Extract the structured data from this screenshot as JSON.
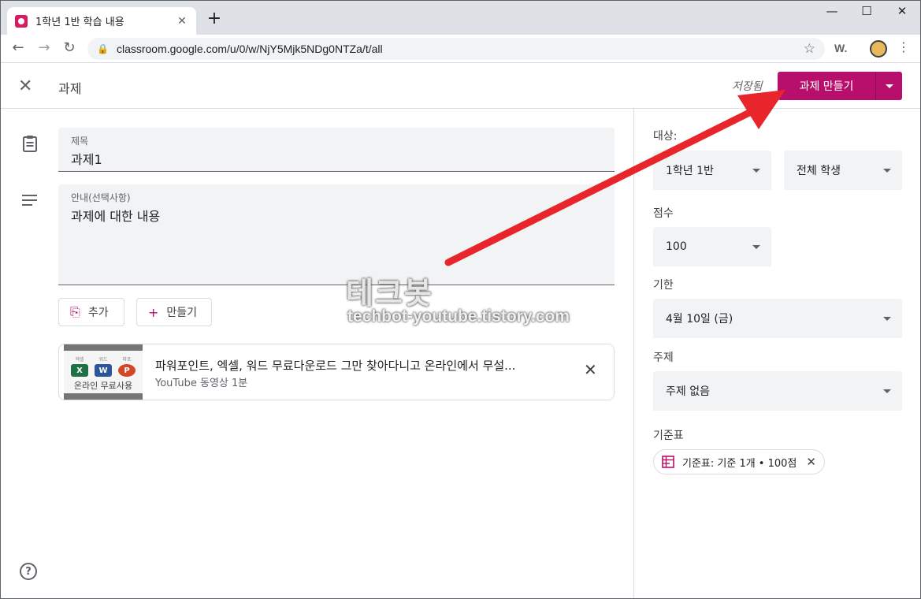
{
  "browser": {
    "tab_title": "1학년 1반 학습 내용",
    "tab_close": "✕",
    "new_tab": "+",
    "url": "classroom.google.com/u/0/w/NjY5Mjk5NDg0NTZa/t/all",
    "ext_label": "W.",
    "window_controls": {
      "minimize": "—",
      "maximize": "☐",
      "close": "✕"
    },
    "nav": {
      "back": "←",
      "forward": "→",
      "reload": "↻",
      "lock": "🔒",
      "star": "☆",
      "menu": "⋮"
    }
  },
  "header": {
    "title": "과제",
    "saved_status": "저장됨",
    "create_button": "과제 만들기",
    "close_icon": "✕"
  },
  "form": {
    "title_label": "제목",
    "title_value": "과제1",
    "instructions_label": "안내(선택사항)",
    "instructions_value": "과제에 대한 내용",
    "add_button": "추가",
    "create_button": "만들기",
    "add_icon": "⎘",
    "create_icon": "+"
  },
  "attachment": {
    "title": "파워포인트, 엑셀, 워드 무료다운로드 그만 찾아다니고 온라인에서 무설...",
    "subtitle": "YouTube 동영상   1분",
    "thumb_labels": [
      "엑셀",
      "워드",
      "파포"
    ],
    "thumb_apps": [
      "X",
      "W",
      "P"
    ],
    "thumb_caption": "온라인 무료사용",
    "close_icon": "✕"
  },
  "panel": {
    "for_label": "대상:",
    "class_value": "1학년 1반",
    "students_value": "전체 학생",
    "points_label": "점수",
    "points_value": "100",
    "due_label": "기한",
    "due_value": "4월 10일 (금)",
    "topic_label": "주제",
    "topic_value": "주제 없음",
    "rubric_label": "기준표",
    "rubric_chip": "기준표: 기준 1개 • 100점",
    "rubric_close": "✕"
  },
  "watermark": {
    "line1": "테크봇",
    "line2": "techbot-youtube.tistory.com"
  },
  "help_icon": "?",
  "colors": {
    "accent": "#b80f6c",
    "arrow": "#e8252b",
    "field_bg": "#f1f3f4"
  }
}
